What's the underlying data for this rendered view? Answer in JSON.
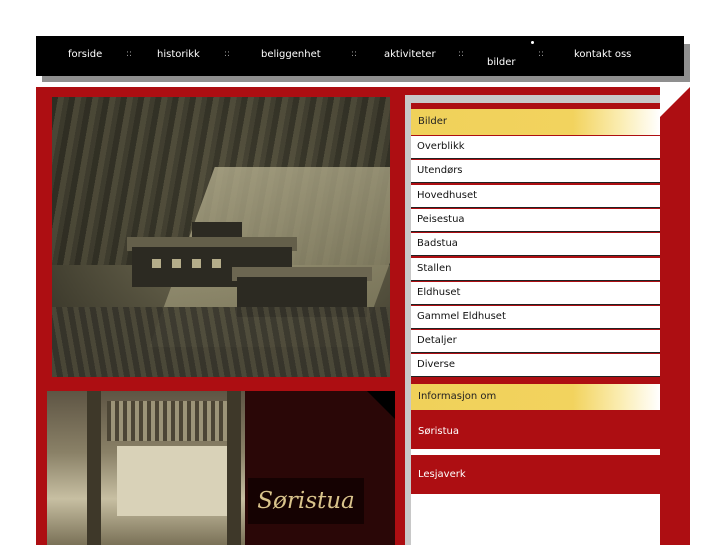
{
  "nav": {
    "items": [
      "forside",
      "historikk",
      "beliggenhet",
      "aktiviteter",
      "bilder",
      "kontakt oss"
    ],
    "separator": "::"
  },
  "photo2": {
    "caption": "Søristua"
  },
  "sidebar": {
    "header": "Bilder",
    "items": [
      "Overblikk",
      "Utendørs",
      "Hovedhuset",
      "Peisestua",
      "Badstua",
      "Stallen",
      "Eldhuset",
      "Gammel Eldhuset",
      "Detaljer",
      "Diverse"
    ],
    "info_header": "Informasjon om",
    "info_links": [
      "Søristua",
      "Lesjaverk"
    ]
  },
  "colors": {
    "brand_red": "#ad0e12",
    "accent_yellow": "#f0d15a",
    "nav_bg": "#000000"
  }
}
